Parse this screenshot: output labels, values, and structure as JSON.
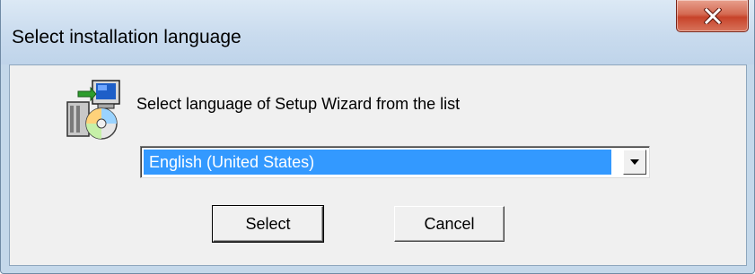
{
  "window": {
    "title": "Select installation language",
    "close_icon": "close-icon",
    "close_button_color": "#c7432a"
  },
  "dialog": {
    "icon": "setup-wizard-icon",
    "prompt": "Select language of Setup Wizard from the list",
    "language_select": {
      "selected": "English (United States)",
      "highlight_color": "#3399ff"
    },
    "buttons": {
      "select_label": "Select",
      "cancel_label": "Cancel"
    }
  }
}
